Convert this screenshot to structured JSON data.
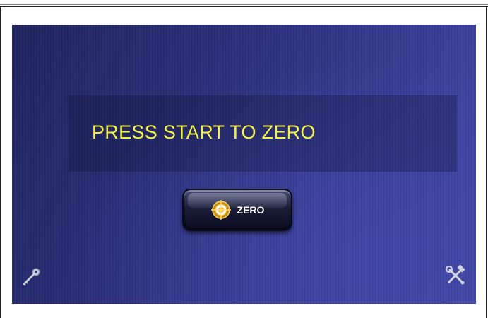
{
  "screen": {
    "message": "PRESS START TO ZERO",
    "zero_button_label": "ZERO"
  },
  "icons": {
    "zero": "crosshair-target-icon",
    "key": "key-icon",
    "tools": "wrench-hammer-icon"
  },
  "colors": {
    "message_text": "#f2f04a",
    "screen_bg": "#2e3388",
    "target_ring": "#f0b020"
  }
}
